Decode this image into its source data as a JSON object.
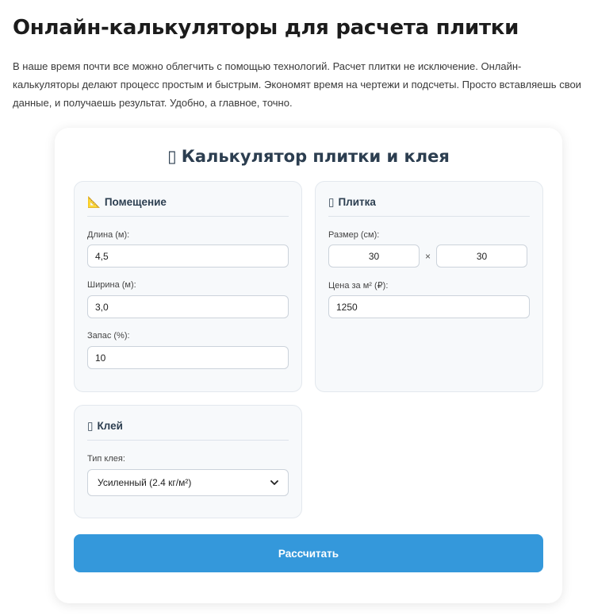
{
  "page": {
    "title": "Онлайн-калькуляторы для расчета плитки",
    "intro": "В наше время почти все можно облегчить с помощью технологий. Расчет плитки не исключение. Онлайн-калькуляторы делают процесс простым и быстрым. Экономят время на чертежи и подсчеты. Просто вставляешь свои данные, и получаешь результат. Удобно, а главное, точно."
  },
  "calculator": {
    "title_glyph": "▯",
    "title": "Калькулятор плитки и клея",
    "room": {
      "glyph": "📐",
      "title": "Помещение",
      "length_label": "Длина (м):",
      "length_value": "4,5",
      "width_label": "Ширина (м):",
      "width_value": "3,0",
      "reserve_label": "Запас (%):",
      "reserve_value": "10"
    },
    "tile": {
      "glyph": "▯",
      "title": "Плитка",
      "size_label": "Размер (см):",
      "size_a": "30",
      "size_sep": "×",
      "size_b": "30",
      "price_label": "Цена за м² (₽):",
      "price_value": "1250"
    },
    "glue": {
      "glyph": "▯",
      "title": "Клей",
      "type_label": "Тип клея:",
      "type_selected": "Усиленный (2.4 кг/м²)"
    },
    "submit_label": "Рассчитать"
  },
  "colors": {
    "accent": "#3498db",
    "heading": "#2c3e50",
    "panel_bg": "#f7f9fb"
  }
}
